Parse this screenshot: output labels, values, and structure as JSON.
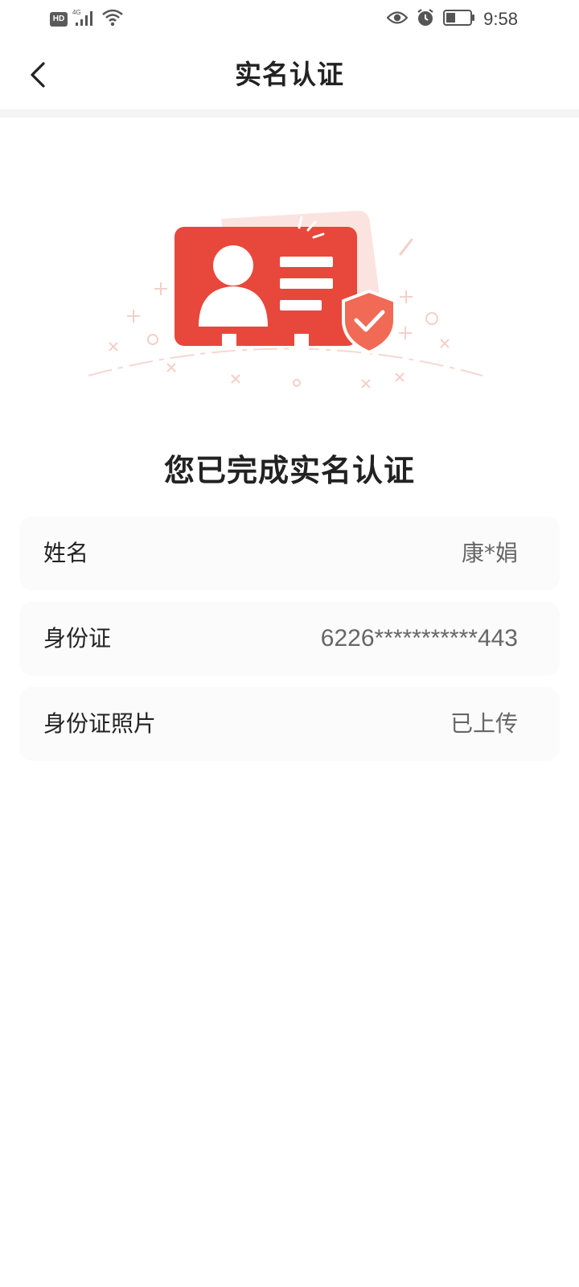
{
  "status_bar": {
    "hd_label": "HD",
    "network_label": "4G",
    "time": "9:58",
    "icons": [
      "hd-icon",
      "signal-icon",
      "wifi-icon",
      "eye-icon",
      "alarm-icon",
      "battery-icon"
    ]
  },
  "header": {
    "title": "实名认证",
    "back_icon": "chevron-left-icon"
  },
  "main": {
    "illustration_icon": "id-card-verified-icon",
    "done_title": "您已完成实名认证",
    "rows": [
      {
        "label": "姓名",
        "value": "康*娟"
      },
      {
        "label": "身份证",
        "value": "6226***********443"
      },
      {
        "label": "身份证照片",
        "value": "已上传"
      }
    ]
  },
  "colors": {
    "accent": "#e8473b",
    "shield": "#f06a55",
    "row_bg": "#fbfbfb",
    "divider": "#f4f4f4"
  }
}
